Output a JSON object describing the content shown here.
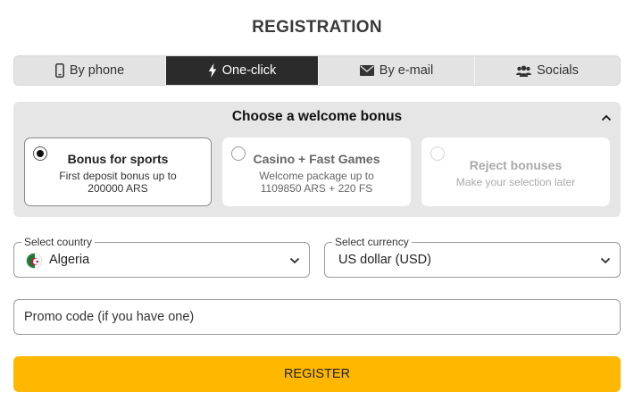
{
  "page": {
    "title": "REGISTRATION"
  },
  "tabs": [
    {
      "label": "By phone",
      "icon": "phone-icon",
      "active": false
    },
    {
      "label": "One-click",
      "icon": "lightning-icon",
      "active": true
    },
    {
      "label": "By e-mail",
      "icon": "envelope-icon",
      "active": false
    },
    {
      "label": "Socials",
      "icon": "users-icon",
      "active": false
    }
  ],
  "bonus": {
    "heading": "Choose a welcome bonus",
    "options": [
      {
        "title": "Bonus for sports",
        "description": "First deposit bonus up to 200000 ARS",
        "desc_line1": "First deposit bonus up to",
        "desc_line2": "200000 ARS",
        "selected": true
      },
      {
        "title": "Casino + Fast Games",
        "description": "Welcome package up to 1109850 ARS + 220 FS",
        "desc_line1": "Welcome package up to",
        "desc_line2": "1109850 ARS + 220 FS",
        "selected": false
      },
      {
        "title": "Reject bonuses",
        "description": "Make your selection later",
        "selected": false
      }
    ]
  },
  "country": {
    "label": "Select country",
    "value": "Algeria",
    "flag": "algeria-flag"
  },
  "currency": {
    "label": "Select currency",
    "value": "US dollar (USD)"
  },
  "promo": {
    "placeholder": "Promo code (if you have one)",
    "value": ""
  },
  "register": {
    "label": "REGISTER"
  },
  "colors": {
    "accent": "#ffb700",
    "active_tab": "#2b2b2b",
    "panel": "#e6e6e6",
    "tabs_bg": "#e3e3e3"
  }
}
